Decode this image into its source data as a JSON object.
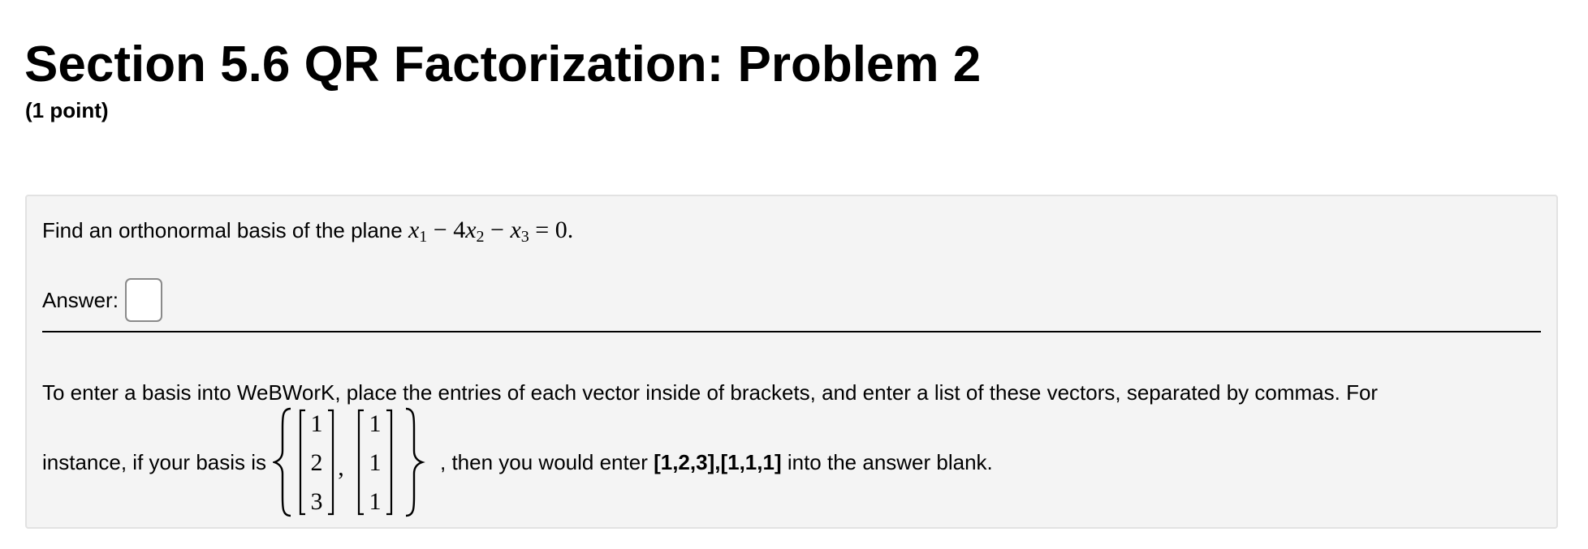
{
  "header": {
    "title": "Section 5.6 QR Factorization: Problem 2",
    "points": "(1 point)"
  },
  "problem": {
    "prompt_prefix": "Find an orthonormal basis of the plane",
    "equation": {
      "terms": [
        {
          "var": "x",
          "sub": "1"
        },
        {
          "op": "−",
          "coef": "4",
          "var": "x",
          "sub": "2"
        },
        {
          "op": "−",
          "var": "x",
          "sub": "3"
        }
      ],
      "rhs": "= 0."
    }
  },
  "answer": {
    "label": "Answer:",
    "value": ""
  },
  "help": {
    "line1": "To enter a basis into WeBWorK, place the entries of each vector inside of brackets, and enter a list of these vectors, separated by commas. For",
    "line2_prefix": "instance, if your basis is",
    "example_vectors": [
      [
        "1",
        "2",
        "3"
      ],
      [
        "1",
        "1",
        "1"
      ]
    ],
    "separator": ",",
    "line2_middle": ", then you would enter",
    "example_entry": "[1,2,3],[1,1,1]",
    "line2_suffix": "into the answer blank."
  }
}
